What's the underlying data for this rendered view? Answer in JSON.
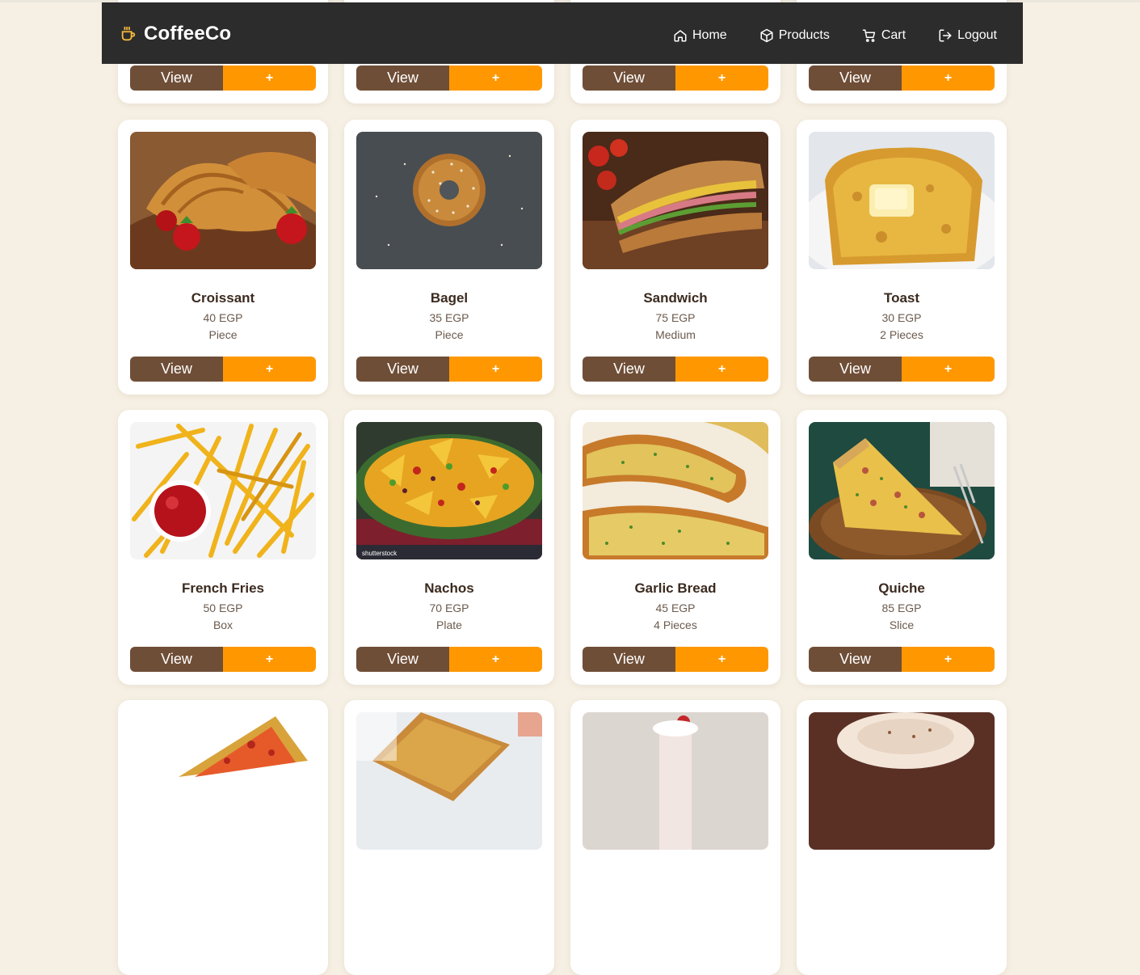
{
  "nav": {
    "brand": "CoffeeCo",
    "brand_icon": "coffee-cup-icon",
    "links": [
      {
        "label": "Home",
        "icon": "home-icon"
      },
      {
        "label": "Products",
        "icon": "box-icon"
      },
      {
        "label": "Cart",
        "icon": "cart-icon"
      },
      {
        "label": "Logout",
        "icon": "logout-icon"
      }
    ]
  },
  "buttons": {
    "view": "View",
    "add": "+"
  },
  "products": [
    {
      "name": "Croissant",
      "price": "40 EGP",
      "unit": "Piece"
    },
    {
      "name": "Bagel",
      "price": "35 EGP",
      "unit": "Piece"
    },
    {
      "name": "Sandwich",
      "price": "75 EGP",
      "unit": "Medium"
    },
    {
      "name": "Toast",
      "price": "30 EGP",
      "unit": "2 Pieces"
    },
    {
      "name": "French Fries",
      "price": "50 EGP",
      "unit": "Box"
    },
    {
      "name": "Nachos",
      "price": "70 EGP",
      "unit": "Plate"
    },
    {
      "name": "Garlic Bread",
      "price": "45 EGP",
      "unit": "4 Pieces"
    },
    {
      "name": "Quiche",
      "price": "85 EGP",
      "unit": "Slice"
    }
  ],
  "image_watermark": "shutterstock",
  "colors": {
    "page_bg": "#f6f0e4",
    "navbar_bg": "#2c2c2c",
    "brand_accent": "#f6b93b",
    "view_button": "#6f4e37",
    "add_button": "#ff9800",
    "product_name": "#3b2a1f",
    "product_meta": "#6b5a4d"
  }
}
